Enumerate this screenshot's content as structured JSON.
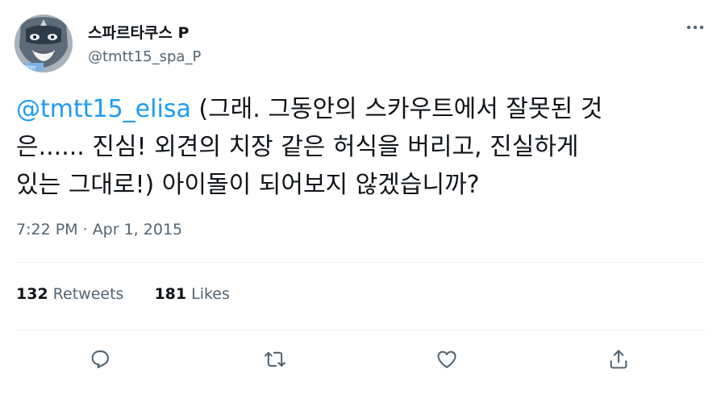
{
  "author": {
    "display_name": "스파르타쿠스 P",
    "handle": "@tmtt15_spa_P"
  },
  "tweet": {
    "mention": "@tmtt15_elisa",
    "line1_rest": " (그래. 그동안의 스카우트에서 잘못된 것",
    "line2": "은...... 진심! 외견의 치장 같은 허식을 버리고, 진실하게",
    "line3": "있는 그대로!) 아이돌이 되어보지 않겠습니까?"
  },
  "meta": {
    "time": "7:22 PM",
    "separator": " · ",
    "date": "Apr 1, 2015"
  },
  "stats": {
    "retweets_count": "132",
    "retweets_label": "Retweets",
    "likes_count": "181",
    "likes_label": "Likes"
  },
  "icons": {
    "more": "more-horizontal-icon",
    "reply": "reply-icon",
    "retweet": "retweet-icon",
    "like": "heart-icon",
    "share": "share-icon"
  },
  "colors": {
    "text": "#0f1419",
    "secondary": "#536471",
    "link": "#1d9bf0",
    "divider": "#eff3f4"
  }
}
